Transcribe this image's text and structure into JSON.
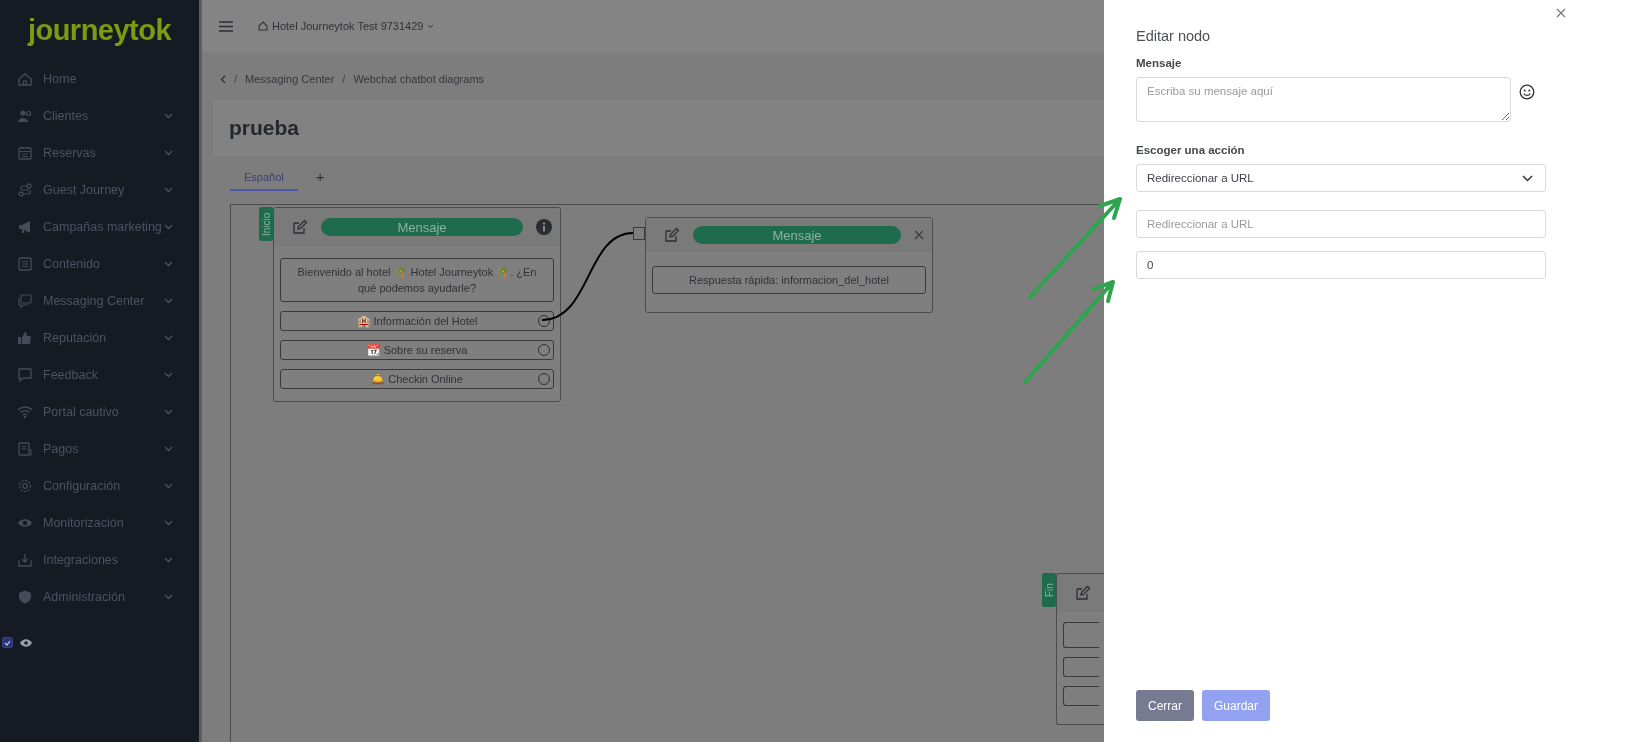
{
  "sidebar": {
    "logo": "journeytok",
    "items": [
      {
        "label": "Home",
        "expandable": false
      },
      {
        "label": "Clientes",
        "expandable": true
      },
      {
        "label": "Reservas",
        "expandable": true
      },
      {
        "label": "Guest Journey",
        "expandable": true
      },
      {
        "label": "Campañas marketing",
        "expandable": true
      },
      {
        "label": "Contenido",
        "expandable": true
      },
      {
        "label": "Messaging Center",
        "expandable": true
      },
      {
        "label": "Reputación",
        "expandable": true
      },
      {
        "label": "Feedback",
        "expandable": true
      },
      {
        "label": "Portal cautivo",
        "expandable": true
      },
      {
        "label": "Pagos",
        "expandable": true
      },
      {
        "label": "Configuración",
        "expandable": true
      },
      {
        "label": "Monitorización",
        "expandable": true
      },
      {
        "label": "Integraciones",
        "expandable": true
      },
      {
        "label": "Administración",
        "expandable": true
      }
    ],
    "preview_toggle": {
      "checked": true
    }
  },
  "topbar": {
    "hotel": "Hotel Journeytok Test 9731429"
  },
  "breadcrumb": [
    {
      "separator": "/",
      "label": "Messaging Center"
    },
    {
      "separator": "/",
      "label": "Webchat chatbot diagrams"
    }
  ],
  "page_title": "prueba",
  "tabs": [
    {
      "label": "Español",
      "selected": true
    }
  ],
  "add_tab": "+",
  "diagram": {
    "nodes": [
      {
        "kind": "start",
        "tag": "Inicio",
        "title": "Mensaje",
        "message": "Bienvenido al hotel 🌴 Hotel Journeytok 🌴. ¿En qué podemos ayudarle?",
        "options": [
          "🏨 Información del Hotel",
          "📆 Sobre su reserva",
          "🛎️ Checkin Online"
        ]
      },
      {
        "kind": "step",
        "title": "Mensaje",
        "message": "Respuesta rápida: informacion_del_hotel"
      },
      {
        "kind": "end",
        "tag": "Fin"
      }
    ]
  },
  "drawer": {
    "title": "Editar nodo",
    "fields": [
      {
        "kind": "textarea",
        "label": "Mensaje",
        "placeholder": "Escriba su mensaje aquí"
      },
      {
        "kind": "select",
        "label": "Escoger una acción",
        "value": "Redireccionar a URL"
      },
      {
        "kind": "input",
        "placeholder": "Redireccionar a URL"
      },
      {
        "kind": "input",
        "value": "0"
      }
    ],
    "buttons": [
      {
        "label": "Cerrar",
        "kind": "secondary",
        "disabled": false
      },
      {
        "label": "Guardar",
        "kind": "primary",
        "disabled": true
      }
    ]
  }
}
